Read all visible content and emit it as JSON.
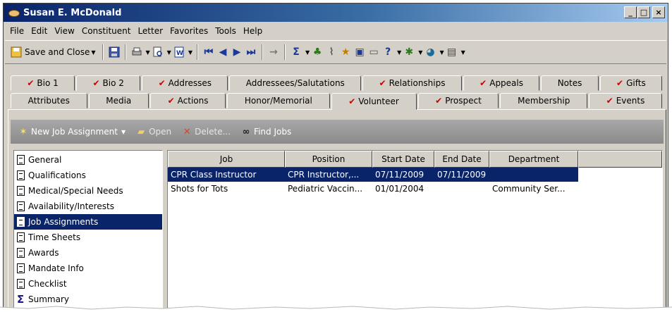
{
  "window": {
    "title": "Susan E. McDonald",
    "buttons": [
      "_",
      "□",
      "×"
    ]
  },
  "menubar": [
    "File",
    "Edit",
    "View",
    "Constituent",
    "Letter",
    "Favorites",
    "Tools",
    "Help"
  ],
  "toolbar": {
    "save_close_label": "Save and Close",
    "icons": [
      "save-icon",
      "print-icon",
      "preview-icon",
      "word-icon",
      "first-record-icon",
      "previous-record-icon",
      "next-record-icon",
      "last-record-icon",
      "go-to-icon",
      "sigma-icon",
      "tree-icon",
      "attach-icon",
      "favorite-icon",
      "properties-icon",
      "card-icon",
      "help-icon",
      "tools-icon",
      "web-icon",
      "notes-icon"
    ]
  },
  "tabs_row1": [
    {
      "label": "Bio 1",
      "checked": true
    },
    {
      "label": "Bio 2",
      "checked": true
    },
    {
      "label": "Addresses",
      "checked": true
    },
    {
      "label": "Addressees/Salutations",
      "checked": false
    },
    {
      "label": "Relationships",
      "checked": true
    },
    {
      "label": "Appeals",
      "checked": true
    },
    {
      "label": "Notes",
      "checked": false
    },
    {
      "label": "Gifts",
      "checked": true
    }
  ],
  "tabs_row2": [
    {
      "label": "Attributes",
      "checked": false
    },
    {
      "label": "Media",
      "checked": false
    },
    {
      "label": "Actions",
      "checked": true
    },
    {
      "label": "Honor/Memorial",
      "checked": false
    },
    {
      "label": "Volunteer",
      "checked": true,
      "active": true
    },
    {
      "label": "Prospect",
      "checked": true
    },
    {
      "label": "Membership",
      "checked": false
    },
    {
      "label": "Events",
      "checked": true
    }
  ],
  "actionbar": {
    "new_label": "New Job Assignment",
    "open_label": "Open",
    "delete_label": "Delete...",
    "find_label": "Find Jobs"
  },
  "nav_items": [
    {
      "label": "General",
      "icon": "document-icon"
    },
    {
      "label": "Qualifications",
      "icon": "document-icon"
    },
    {
      "label": "Medical/Special Needs",
      "icon": "document-icon"
    },
    {
      "label": "Availability/Interests",
      "icon": "document-icon"
    },
    {
      "label": "Job Assignments",
      "icon": "document-icon",
      "selected": true
    },
    {
      "label": "Time Sheets",
      "icon": "document-icon"
    },
    {
      "label": "Awards",
      "icon": "document-icon"
    },
    {
      "label": "Mandate Info",
      "icon": "document-icon"
    },
    {
      "label": "Checklist",
      "icon": "document-icon"
    },
    {
      "label": "Summary",
      "icon": "sigma-icon"
    }
  ],
  "grid": {
    "columns": [
      "Job",
      "Position",
      "Start Date",
      "End Date",
      "Department"
    ],
    "rows": [
      {
        "job": "CPR Class Instructor",
        "position": "CPR Instructor,...",
        "start": "07/11/2009",
        "end": "07/11/2009",
        "department": "",
        "selected": true
      },
      {
        "job": "Shots for Tots",
        "position": "Pediatric Vaccin...",
        "start": "01/01/2004",
        "end": "",
        "department": "Community Ser..."
      }
    ]
  },
  "colors": {
    "title_bar": "#0a246a",
    "selection": "#0a246a",
    "check": "#cc0000",
    "chrome": "#d4d0c8"
  }
}
